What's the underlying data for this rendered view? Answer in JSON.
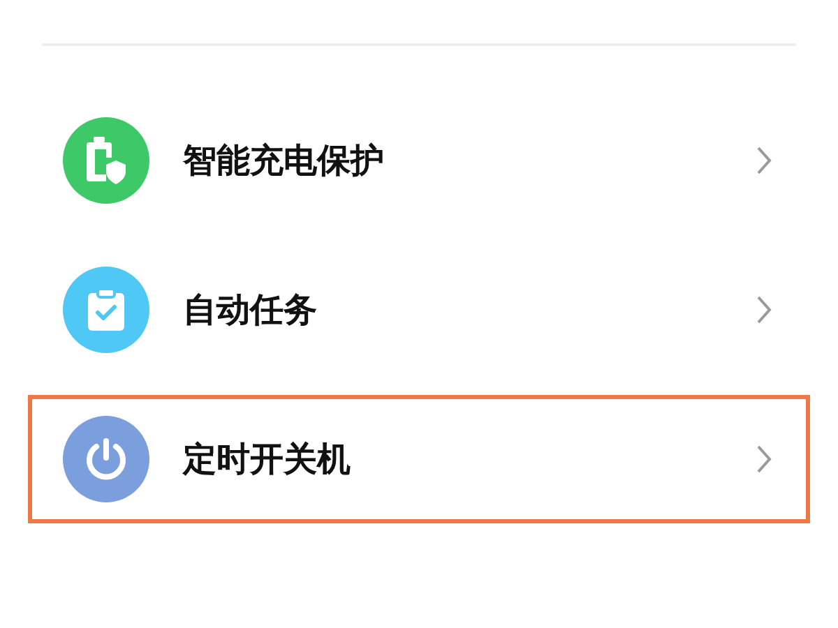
{
  "settings": [
    {
      "label": "智能充电保护",
      "kind": "battery",
      "color": "#3ec968",
      "selected": false
    },
    {
      "label": "自动任务",
      "kind": "clipboard",
      "color": "#4fc8f5",
      "selected": false
    },
    {
      "label": "定时开关机",
      "kind": "power",
      "color": "#7b9fdc",
      "selected": true
    }
  ]
}
